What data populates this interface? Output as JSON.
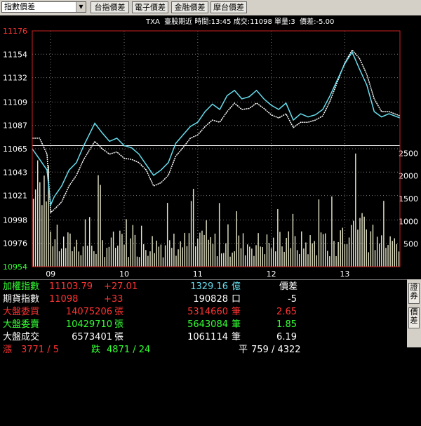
{
  "toolbar": {
    "selector": "指數價差",
    "buttons": [
      "台指價差",
      "電子價差",
      "金融價差",
      "摩台價差"
    ]
  },
  "info_bar": "TXA  臺股期近 時間:13:45 成交:11098 單量:3  價差:-5.00",
  "chart_data": {
    "type": "line",
    "title": "",
    "x_ticks": [
      "09",
      "10",
      "11",
      "12",
      "13"
    ],
    "y_ticks": [
      11176,
      11154,
      11132,
      11109,
      11087,
      11065,
      11043,
      11021,
      10998,
      10976,
      10954
    ],
    "volume_ticks": [
      2500,
      2000,
      1500,
      1000,
      500
    ],
    "ylim": [
      10954,
      11176
    ],
    "volume_lim": [
      0,
      3000
    ],
    "reference_level": 11068,
    "series": [
      {
        "color": "#66ddee",
        "x": [
          8.75,
          8.85,
          8.95,
          9.0,
          9.05,
          9.15,
          9.25,
          9.35,
          9.45,
          9.6,
          9.7,
          9.8,
          9.9,
          10.0,
          10.1,
          10.2,
          10.3,
          10.4,
          10.5,
          10.6,
          10.7,
          10.8,
          10.9,
          11.0,
          11.1,
          11.2,
          11.3,
          11.4,
          11.5,
          11.6,
          11.7,
          11.8,
          11.9,
          12.0,
          12.1,
          12.2,
          12.3,
          12.4,
          12.5,
          12.6,
          12.7,
          12.8,
          12.9,
          13.0,
          13.1,
          13.2,
          13.3,
          13.4,
          13.5,
          13.6,
          13.75
        ],
        "values": [
          11065,
          11055,
          11045,
          11012,
          11020,
          11030,
          11045,
          11052,
          11068,
          11089,
          11080,
          11072,
          11075,
          11068,
          11066,
          11060,
          11050,
          11040,
          11045,
          11052,
          11070,
          11078,
          11086,
          11090,
          11100,
          11107,
          11102,
          11115,
          11120,
          11112,
          11114,
          11120,
          11112,
          11106,
          11102,
          11108,
          11092,
          11098,
          11095,
          11097,
          11102,
          11115,
          11130,
          11145,
          11156,
          11140,
          11125,
          11100,
          11095,
          11098,
          11094
        ]
      },
      {
        "color": "#ffffff",
        "x": [
          8.75,
          8.85,
          8.95,
          9.0,
          9.05,
          9.15,
          9.25,
          9.35,
          9.45,
          9.6,
          9.7,
          9.8,
          9.9,
          10.0,
          10.1,
          10.2,
          10.3,
          10.4,
          10.5,
          10.6,
          10.7,
          10.8,
          10.9,
          11.0,
          11.1,
          11.2,
          11.3,
          11.4,
          11.5,
          11.6,
          11.7,
          11.8,
          11.9,
          12.0,
          12.1,
          12.2,
          12.3,
          12.4,
          12.5,
          12.6,
          12.7,
          12.8,
          12.9,
          13.0,
          13.1,
          13.2,
          13.3,
          13.4,
          13.5,
          13.6,
          13.75
        ],
        "values": [
          11075,
          11075,
          11060,
          11005,
          11008,
          11015,
          11030,
          11040,
          11055,
          11072,
          11065,
          11060,
          11062,
          11056,
          11055,
          11052,
          11045,
          11030,
          11033,
          11040,
          11058,
          11066,
          11075,
          11078,
          11086,
          11092,
          11090,
          11100,
          11108,
          11102,
          11103,
          11108,
          11103,
          11097,
          11094,
          11098,
          11085,
          11090,
          11090,
          11092,
          11096,
          11110,
          11128,
          11146,
          11158,
          11150,
          11135,
          11112,
          11100,
          11100,
          11096
        ]
      }
    ]
  },
  "bottom": {
    "rows": [
      {
        "label": "加權指數",
        "v1": "11103.79",
        "v2": "+27.01",
        "v3": "1329.16",
        "u1": "億",
        "v4": "價差"
      },
      {
        "label": "期貨指數",
        "v1": "11098",
        "v2": "+33",
        "v3": "190828",
        "u1": "口",
        "v4": "-5"
      },
      {
        "label": "大盤委買",
        "v1": "14075206",
        "u0": "張",
        "v3": "5314660",
        "u1": "筆",
        "v4": "2.65"
      },
      {
        "label": "大盤委賣",
        "v1": "10429710",
        "u0": "張",
        "v3": "5643084",
        "u1": "筆",
        "v4": "1.85"
      },
      {
        "label": "大盤成交",
        "v1": "6573401",
        "u0": "張",
        "v3": "1061114",
        "u1": "筆",
        "v4": "6.19"
      }
    ],
    "stats": {
      "up_label": "漲",
      "up": "3771 / 5",
      "down_label": "跌",
      "down": "4871 / 24",
      "flat_label": "平",
      "flat": "759 / 4322"
    }
  },
  "side_tabs": [
    "證券",
    "價差"
  ],
  "colors": {
    "cyan": "#66ddee",
    "red": "#ff3333",
    "green": "#33ff33",
    "frame": "#cc2222",
    "volume": "#e6e6c8"
  }
}
